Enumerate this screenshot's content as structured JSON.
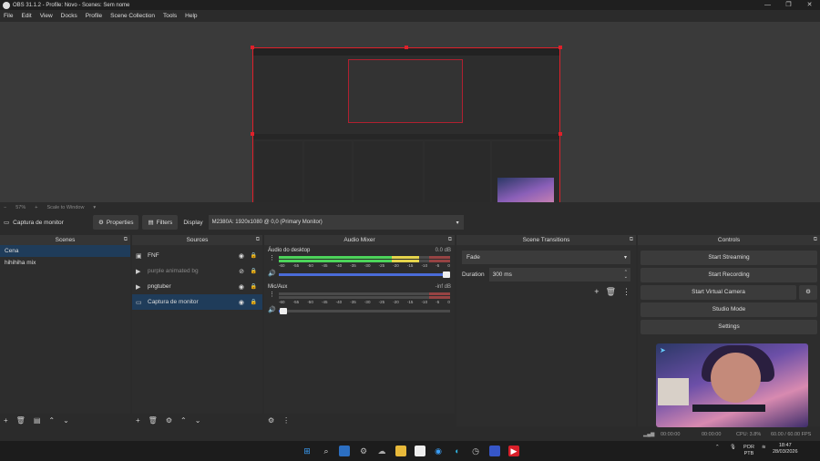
{
  "window": {
    "title": "OBS 31.1.2 - Profile: Novo - Scenes: Sem nome",
    "controls": [
      "—",
      "❐",
      "✕"
    ]
  },
  "menu": [
    "File",
    "Edit",
    "View",
    "Docks",
    "Profile",
    "Scene Collection",
    "Tools",
    "Help"
  ],
  "zoom": {
    "minus": "−",
    "value": "57%",
    "plus": "+",
    "mode": "Scale to Window"
  },
  "properties_bar": {
    "source": "Captura de monitor",
    "properties": "Properties",
    "filters": "Filters",
    "display_label": "Display",
    "display_value": "M2380A: 1920x1080 @ 0,0 (Primary Monitor)"
  },
  "scenes": {
    "title": "Scenes",
    "items": [
      "Cena",
      "hihihiha mix"
    ],
    "selected": 0
  },
  "sources": {
    "title": "Sources",
    "items": [
      {
        "label": "FNF",
        "icon": "window-icon",
        "visible": true,
        "dim": false
      },
      {
        "label": "purple animated bg",
        "icon": "play-icon",
        "visible": false,
        "dim": true
      },
      {
        "label": "pngtuber",
        "icon": "play-icon",
        "visible": true,
        "dim": false
      },
      {
        "label": "Captura de monitor",
        "icon": "monitor-icon",
        "visible": true,
        "dim": false
      }
    ],
    "selected": 3
  },
  "mixer": {
    "title": "Audio Mixer",
    "channels": [
      {
        "name": "Áudio do desktop",
        "db": "0.0 dB",
        "level": 0.82,
        "volume": 1.0
      },
      {
        "name": "Mic/Aux",
        "db": "-inf dB",
        "level": 0.0,
        "volume": 0.05
      }
    ],
    "ticks": [
      "-60",
      "-55",
      "-50",
      "-45",
      "-40",
      "-35",
      "-30",
      "-25",
      "-20",
      "-15",
      "-10",
      "-5",
      "0"
    ]
  },
  "transitions": {
    "title": "Scene Transitions",
    "type": "Fade",
    "duration_label": "Duration",
    "duration": "300 ms"
  },
  "controls": {
    "title": "Controls",
    "start_streaming": "Start Streaming",
    "start_recording": "Start Recording",
    "start_virtual_camera": "Start Virtual Camera",
    "studio_mode": "Studio Mode",
    "settings": "Settings"
  },
  "status": {
    "stream_time": "00:00:00",
    "rec_time": "00:00:00",
    "cpu": "CPU: 3.8%",
    "fps": "60.00 / 60.00 FPS"
  },
  "tray": {
    "lang1": "POR",
    "lang2": "PTB",
    "time": "18:47",
    "date": "28/03/2026"
  },
  "colors": {
    "accent_selection": "#1f3c5a",
    "selection_border": "#e0202a",
    "meter_green": "#4cd45a",
    "meter_yellow": "#e5d44b",
    "meter_red": "#c94040"
  }
}
